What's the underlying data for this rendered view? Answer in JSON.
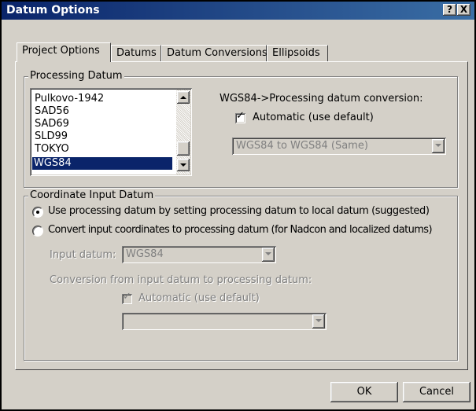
{
  "window": {
    "title": "Datum Options",
    "help_btn": "?",
    "close_btn": "X"
  },
  "tabs": [
    {
      "label": "Project Options",
      "active": true
    },
    {
      "label": "Datums"
    },
    {
      "label": "Datum Conversions"
    },
    {
      "label": "Ellipsoids"
    }
  ],
  "processing_datum": {
    "group_label": "Processing Datum",
    "list": [
      "Pulkovo-1942",
      "SAD56",
      "SAD69",
      "SLD99",
      "TOKYO",
      "WGS84"
    ],
    "selected": "WGS84",
    "conversion_label": "WGS84->Processing datum conversion:",
    "automatic_label": "Automatic (use default)",
    "automatic_checked": true,
    "conversion_value": "WGS84 to WGS84 (Same)"
  },
  "coordinate_input": {
    "group_label": "Coordinate Input Datum",
    "option1": "Use processing datum by setting processing datum to local datum (suggested)",
    "option2": "Convert input coordinates to processing datum (for Nadcon and localized datums)",
    "selected_option": 1,
    "input_datum_label": "Input datum:",
    "input_datum_value": "WGS84",
    "conversion_label": "Conversion from input datum to processing datum:",
    "automatic_label": "Automatic (use default)",
    "conversion_value": ""
  },
  "buttons": {
    "ok": "OK",
    "cancel": "Cancel"
  }
}
